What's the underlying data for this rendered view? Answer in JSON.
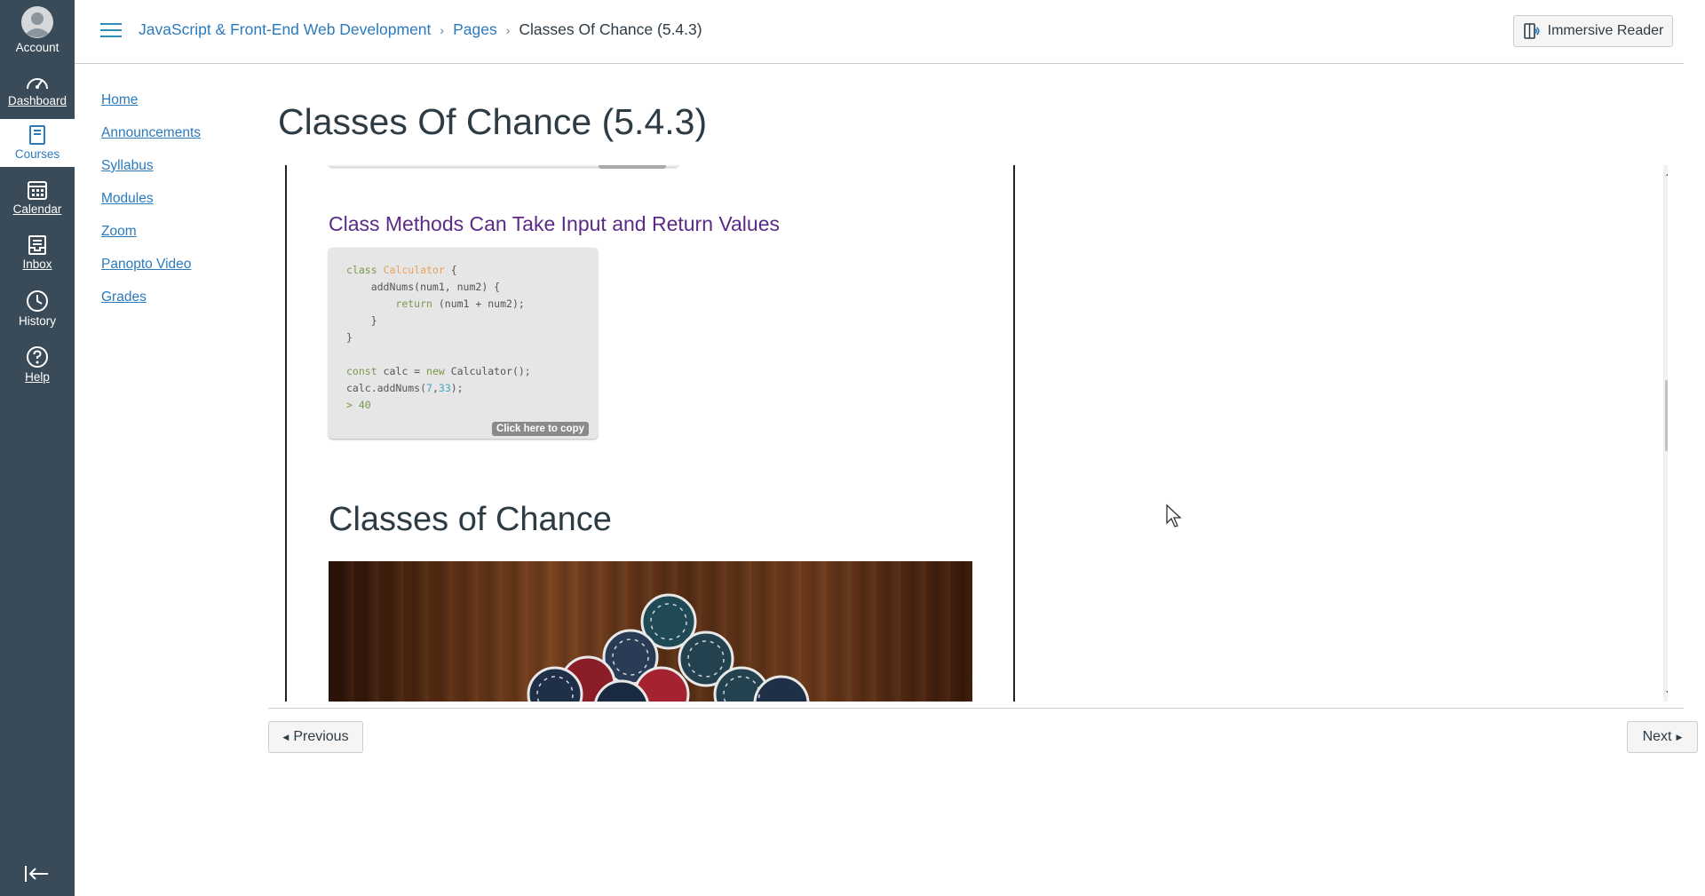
{
  "global_nav": {
    "account": "Account",
    "dashboard": "Dashboard",
    "courses": "Courses",
    "calendar": "Calendar",
    "inbox": "Inbox",
    "history": "History",
    "help": "Help"
  },
  "breadcrumb": {
    "course": "JavaScript & Front-End Web Development",
    "section": "Pages",
    "current": "Classes Of Chance (5.4.3)"
  },
  "header": {
    "immersive_reader": "Immersive Reader"
  },
  "course_nav": {
    "items": [
      {
        "label": "Home"
      },
      {
        "label": "Announcements"
      },
      {
        "label": "Syllabus"
      },
      {
        "label": "Modules"
      },
      {
        "label": "Zoom"
      },
      {
        "label": "Panopto Video"
      },
      {
        "label": "Grades"
      }
    ]
  },
  "page": {
    "title": "Classes Of Chance (5.4.3)",
    "section_heading": "Class Methods Can Take Input and Return Values",
    "copy_label": "Click here to copy",
    "big_heading": "Classes of Chance"
  },
  "footer": {
    "previous": "Previous",
    "next": "Next"
  },
  "icons": {
    "account": "account-avatar-icon",
    "dashboard": "speedometer-icon",
    "courses": "book-icon",
    "calendar": "calendar-icon",
    "inbox": "inbox-icon",
    "history": "clock-icon",
    "help": "question-circle-icon",
    "collapse": "collapse-arrow-icon"
  },
  "colors": {
    "nav_bg": "#394b58",
    "link": "#2b7abc",
    "heading_purple": "#5b2a86"
  }
}
